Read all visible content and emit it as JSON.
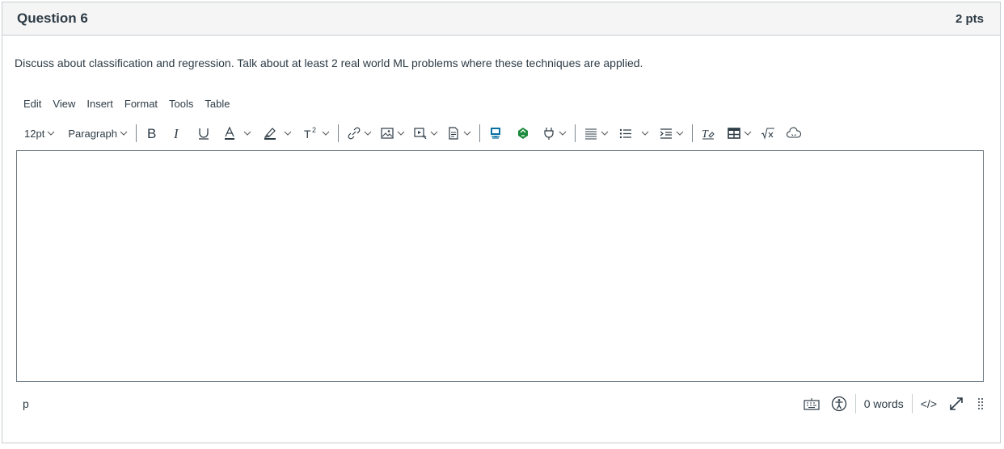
{
  "question": {
    "title": "Question 6",
    "points": "2 pts",
    "prompt": "Discuss about classification and regression. Talk about at least 2 real world ML problems where these techniques are applied."
  },
  "menubar": [
    "Edit",
    "View",
    "Insert",
    "Format",
    "Tools",
    "Table"
  ],
  "toolbar": {
    "font_size": "12pt",
    "block_format": "Paragraph",
    "bold_icon": "bold-icon",
    "italic_icon": "italic-icon",
    "underline_icon": "underline-icon",
    "text_color_icon": "text-color-icon",
    "highlight_icon": "highlight-icon",
    "superscript_icon": "superscript-icon",
    "link_icon": "link-icon",
    "image_icon": "image-icon",
    "media_icon": "media-icon",
    "document_icon": "document-icon",
    "accent_color": "#0770a3",
    "green_color": "#1b8a3a"
  },
  "statusbar": {
    "path": "p",
    "word_count": "0 words",
    "html_toggle": "</>"
  }
}
